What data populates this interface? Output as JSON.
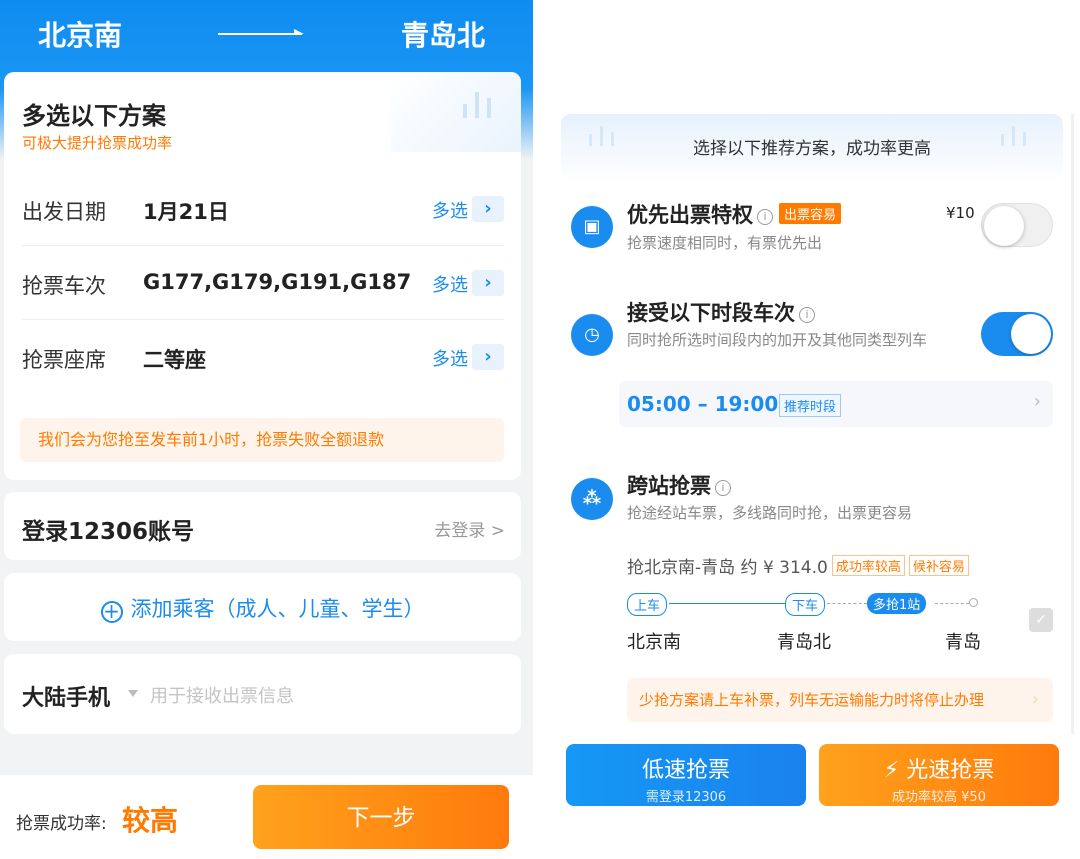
{
  "left": {
    "route": {
      "from": "北京南",
      "to": "青岛北"
    },
    "plan": {
      "title": "多选以下方案",
      "subtitle": "可极大提升抢票成功率",
      "rows": [
        {
          "label": "出发日期",
          "value": "1月21日",
          "action": "多选"
        },
        {
          "label": "抢票车次",
          "value": "G177,G179,G191,G187",
          "action": "多选"
        },
        {
          "label": "抢票座席",
          "value": "二等座",
          "action": "多选"
        }
      ],
      "notice": "我们会为您抢至发车前1小时，抢票失败全额退款"
    },
    "login": {
      "title": "登录12306账号",
      "action": "去登录 >"
    },
    "add_passenger": {
      "icon": "plus-circle-icon",
      "label": "添加乘客（成人、儿童、学生）"
    },
    "phone": {
      "label": "大陆手机",
      "placeholder": "用于接收出票信息"
    },
    "bottom": {
      "rate_label": "抢票成功率:",
      "rate_value": "较高",
      "next_label": "下一步"
    }
  },
  "right": {
    "header": "选择以下推荐方案，成功率更高",
    "priority": {
      "title": "优先出票特权",
      "tag": "出票容易",
      "desc": "抢票速度相同时，有票优先出",
      "price": "¥10",
      "enabled": false
    },
    "time_period": {
      "title": "接受以下时段车次",
      "desc": "同时抢所选时间段内的加开及其他同类型列车",
      "time_range": "05:00 – 19:00",
      "time_tag": "推荐时段",
      "enabled": true
    },
    "cross_station": {
      "title": "跨站抢票",
      "desc": "抢途经站车票，多线路同时抢，出票更容易",
      "route_text": "抢北京南-青岛 约 ¥ 314.0",
      "tags": [
        "成功率较高",
        "候补容易"
      ],
      "pills": {
        "board": "上车",
        "alight": "下车",
        "extra": "多抢1站"
      },
      "stations": [
        "北京南",
        "青岛北",
        "青岛"
      ],
      "warning": "少抢方案请上车补票，列车无运输能力时将停止办理"
    },
    "buttons": {
      "slow": {
        "label": "低速抢票",
        "sub": "需登录12306"
      },
      "fast": {
        "label": "⚡ 光速抢票",
        "sub": "成功率较高  ¥50"
      }
    }
  }
}
